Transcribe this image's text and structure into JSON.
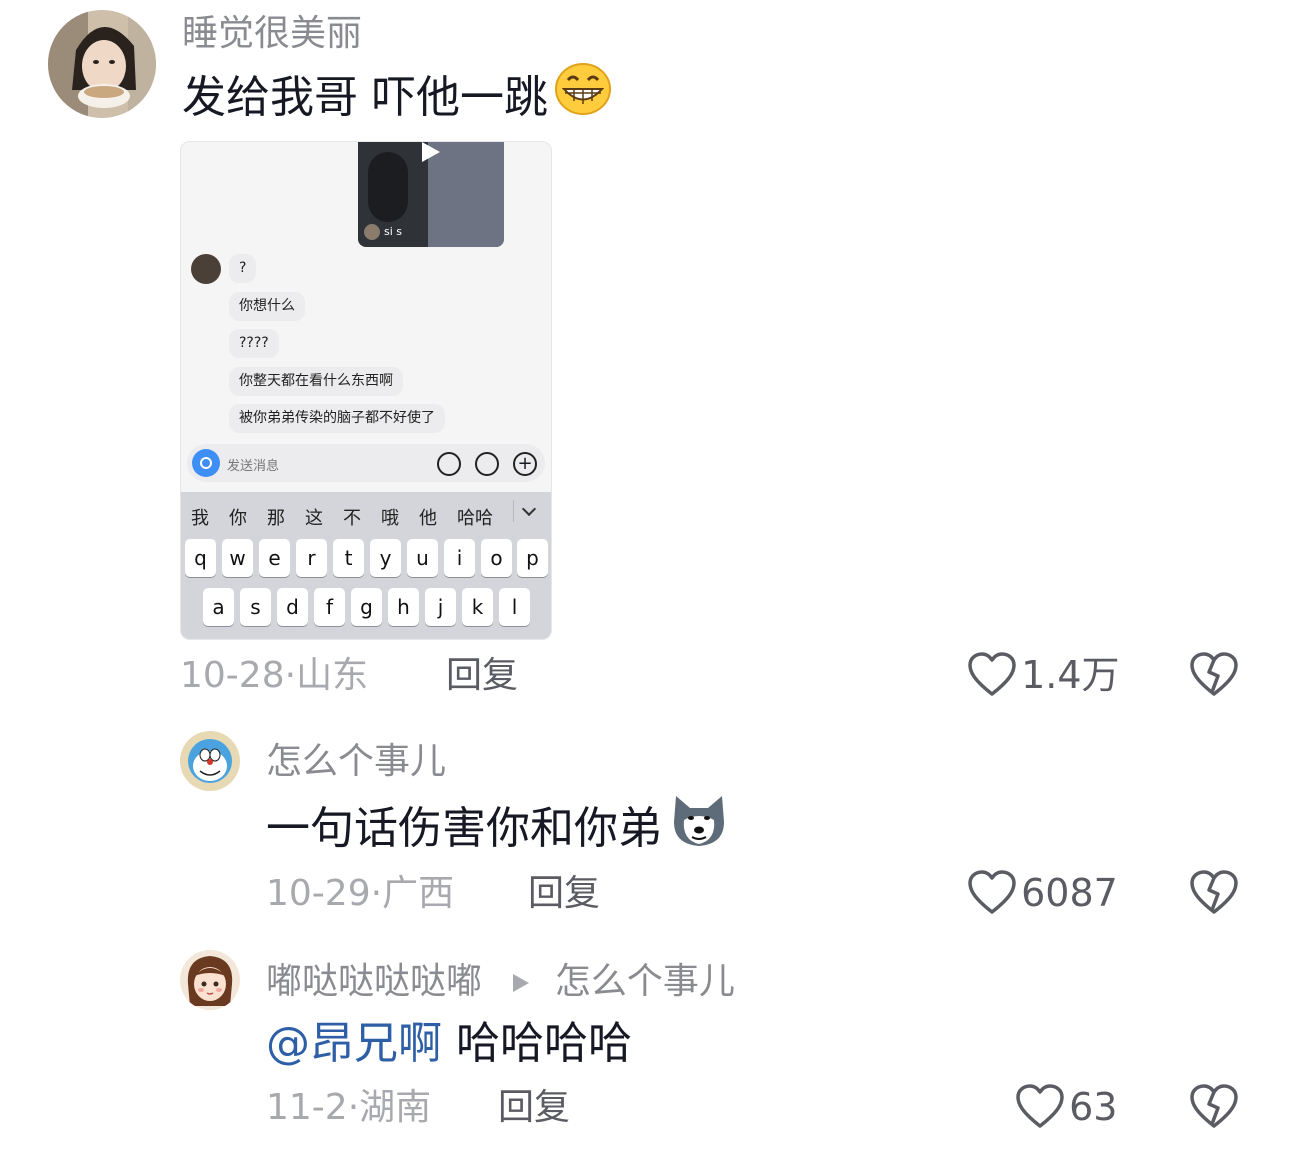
{
  "comments": [
    {
      "username": "睡觉很美丽",
      "text": "发给我哥 吓他一跳",
      "emoji": "grin-emoji",
      "date": "10-28",
      "location": "山东",
      "reply_label": "回复",
      "likes": "1.4万"
    },
    {
      "username": "怎么个事儿",
      "text": "一句话伤害你和你弟",
      "emoji": "husky-emoji",
      "date": "10-29",
      "location": "广西",
      "reply_label": "回复",
      "likes": "6087"
    },
    {
      "username": "嘟哒哒哒哒嘟",
      "reply_to": "怎么个事儿",
      "mention": "@昂兄啊",
      "text": "哈哈哈哈",
      "date": "11-2",
      "location": "湖南",
      "reply_label": "回复",
      "likes": "63"
    }
  ],
  "embedded_screenshot": {
    "video_user": "si s",
    "messages": [
      "?",
      "你想什么",
      "????",
      "你整天都在看什么东西啊",
      "被你弟弟传染的脑子都不好使了"
    ],
    "input_placeholder": "发送消息",
    "candidates": [
      "我",
      "你",
      "那",
      "这",
      "不",
      "哦",
      "他",
      "哈哈"
    ],
    "keys_row1": [
      "q",
      "w",
      "e",
      "r",
      "t",
      "y",
      "u",
      "i",
      "o",
      "p"
    ],
    "keys_row2": [
      "a",
      "s",
      "d",
      "f",
      "g",
      "h",
      "j",
      "k",
      "l"
    ]
  },
  "colors": {
    "mention": "#2e5fa6",
    "username": "#8a8b91",
    "meta": "#a8a9ae"
  }
}
